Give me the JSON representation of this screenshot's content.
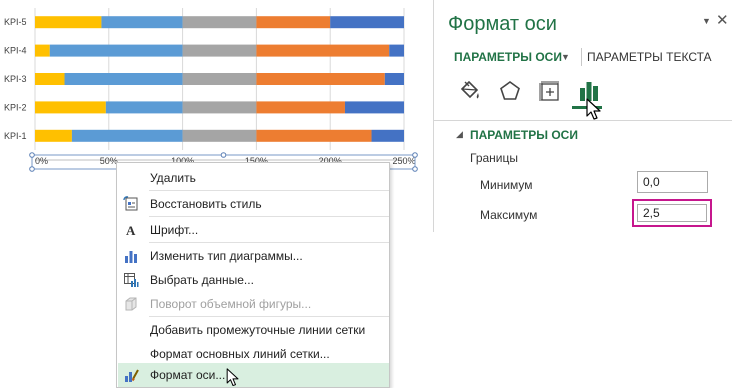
{
  "chart_data": {
    "type": "bar",
    "orientation": "horizontal",
    "stacked": true,
    "categories": [
      "KPI-5",
      "KPI-4",
      "KPI-3",
      "KPI-2",
      "KPI-1"
    ],
    "series": [
      {
        "color": "#FFC000",
        "values": [
          0.45,
          0.1,
          0.2,
          0.48,
          0.25
        ]
      },
      {
        "color": "#5B9BD5",
        "values": [
          0.55,
          0.9,
          0.8,
          0.52,
          0.75
        ]
      },
      {
        "color": "#A5A5A5",
        "values": [
          0.5,
          0.5,
          0.5,
          0.5,
          0.5
        ]
      },
      {
        "color": "#ED7D31",
        "values": [
          0.5,
          0.9,
          0.87,
          0.6,
          0.78
        ]
      },
      {
        "color": "#4472C4",
        "values": [
          0.5,
          0.1,
          0.13,
          0.4,
          0.22
        ]
      }
    ],
    "x_ticks": [
      "0%",
      "50%",
      "100%",
      "150%",
      "200%",
      "250%"
    ],
    "xlim": [
      0,
      2.5
    ],
    "grid": true,
    "legend": "none"
  },
  "pane": {
    "title": "Формат оси",
    "collapse_glyph": "▼",
    "close_glyph": "✕",
    "tab_axis": "ПАРАМЕТРЫ ОСИ",
    "tab_axis_caret": "▼",
    "tab_text": "ПАРАМЕТРЫ ТЕКСТА",
    "icons": [
      "paint-bucket-icon",
      "pentagon-icon",
      "size-properties-icon",
      "bar-chart-icon"
    ],
    "section_caret": "◢",
    "section_title": "ПАРАМЕТРЫ ОСИ",
    "bounds_label": "Границы",
    "min_label": "Минимум",
    "min_value": "0,0",
    "max_label": "Максимум",
    "max_value": "2,5",
    "accent": "#217346",
    "highlight": "#C6168D"
  },
  "menu": {
    "items": [
      {
        "label": "Удалить",
        "icon": "",
        "disabled": false
      },
      {
        "label": "Восстановить стиль",
        "icon": "reset-style-icon",
        "disabled": false
      },
      {
        "label": "Шрифт...",
        "icon": "font-icon",
        "disabled": false
      },
      {
        "label": "Изменить тип диаграммы...",
        "icon": "chart-type-icon",
        "disabled": false
      },
      {
        "label": "Выбрать данные...",
        "icon": "select-data-icon",
        "disabled": false
      },
      {
        "label": "Поворот объемной фигуры...",
        "icon": "3d-rotation-icon",
        "disabled": true
      },
      {
        "label": "Добавить промежуточные линии сетки",
        "icon": "",
        "disabled": false
      },
      {
        "label": "Формат основных линий сетки...",
        "icon": "",
        "disabled": false
      },
      {
        "label": "Формат оси...",
        "icon": "format-axis-icon",
        "disabled": false,
        "active": true
      }
    ]
  }
}
